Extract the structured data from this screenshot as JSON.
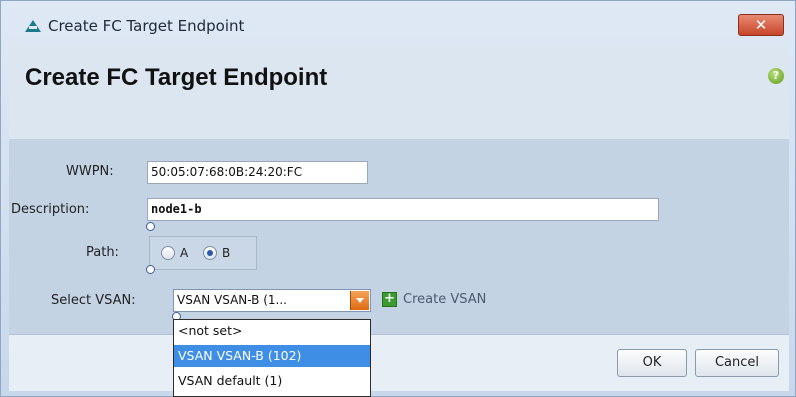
{
  "window": {
    "title": "Create FC Target Endpoint",
    "close_label": "✕"
  },
  "header": {
    "heading": "Create FC Target Endpoint",
    "help_glyph": "?"
  },
  "form": {
    "wwpn": {
      "label": "WWPN:",
      "value": "50:05:07:68:0B:24:20:FC"
    },
    "description": {
      "label": "Description:",
      "value": "node1-b"
    },
    "path": {
      "label": "Path:",
      "options": [
        {
          "label": "A",
          "checked": false
        },
        {
          "label": "B",
          "checked": true
        }
      ]
    },
    "vsan": {
      "label": "Select VSAN:",
      "selected_text": "VSAN VSAN-B (1...",
      "create_label": "Create VSAN",
      "options": [
        "<not set>",
        "VSAN VSAN-B (102)",
        "VSAN default (1)"
      ],
      "highlighted_option": "VSAN VSAN-B (102)"
    }
  },
  "footer": {
    "ok_label": "OK",
    "cancel_label": "Cancel"
  },
  "colors": {
    "accent_orange": "#e06a10",
    "highlight_blue": "#3d8ee4",
    "close_red": "#c8462a",
    "create_green": "#3c9b2f"
  },
  "icons": {
    "app": "triangle-app-icon",
    "close": "close-icon",
    "help": "help-icon",
    "plus": "plus-icon",
    "dropdown": "chevron-down-icon"
  }
}
